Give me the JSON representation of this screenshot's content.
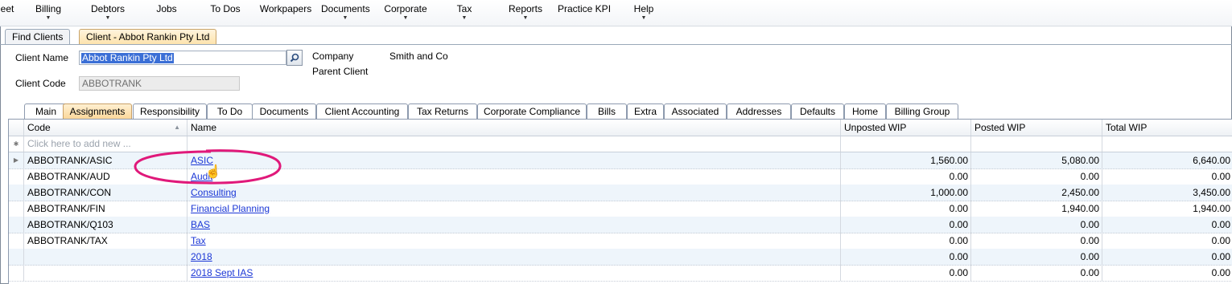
{
  "menu": [
    {
      "label": "eet",
      "dropdown": false
    },
    {
      "label": "Billing",
      "dropdown": true
    },
    {
      "label": "Debtors",
      "dropdown": true
    },
    {
      "label": "Jobs",
      "dropdown": false
    },
    {
      "label": "To Dos",
      "dropdown": false
    },
    {
      "label": "Workpapers",
      "dropdown": false
    },
    {
      "label": "Documents",
      "dropdown": true
    },
    {
      "label": "Corporate",
      "dropdown": true
    },
    {
      "label": "Tax",
      "dropdown": true
    },
    {
      "label": "Reports",
      "dropdown": true
    },
    {
      "label": "Practice KPI",
      "dropdown": false
    },
    {
      "label": "Help",
      "dropdown": true
    }
  ],
  "doc_tabs": [
    {
      "label": "Find Clients",
      "active": false
    },
    {
      "label": "Client - Abbot Rankin Pty Ltd",
      "active": true
    }
  ],
  "header": {
    "client_name_label": "Client Name",
    "client_name_value": "Abbot Rankin Pty Ltd",
    "client_code_label": "Client Code",
    "client_code_value": "ABBOTRANK",
    "company_label": "Company",
    "company_value": "Smith and Co",
    "parent_client_label": "Parent Client"
  },
  "detail_tabs": [
    {
      "label": "Main",
      "active": false
    },
    {
      "label": "Assignments",
      "active": true
    },
    {
      "label": "Responsibility",
      "active": false
    },
    {
      "label": "To Do",
      "active": false
    },
    {
      "label": "Documents",
      "active": false
    },
    {
      "label": "Client Accounting",
      "active": false
    },
    {
      "label": "Tax Returns",
      "active": false
    },
    {
      "label": "Corporate Compliance",
      "active": false
    },
    {
      "label": "Bills",
      "active": false
    },
    {
      "label": "Extra",
      "active": false
    },
    {
      "label": "Associated",
      "active": false
    },
    {
      "label": "Addresses",
      "active": false
    },
    {
      "label": "Defaults",
      "active": false
    },
    {
      "label": "Home",
      "active": false
    },
    {
      "label": "Billing Group",
      "active": false
    }
  ],
  "grid": {
    "columns": [
      "Code",
      "Name",
      "Unposted WIP",
      "Posted WIP",
      "Total WIP"
    ],
    "new_row_placeholder": "Click here to add new ...",
    "rows": [
      {
        "code": "ABBOTRANK/ASIC",
        "name": "ASIC",
        "unposted": "1,560.00",
        "posted": "5,080.00",
        "total": "6,640.00"
      },
      {
        "code": "ABBOTRANK/AUD",
        "name": "Audit",
        "unposted": "0.00",
        "posted": "0.00",
        "total": "0.00"
      },
      {
        "code": "ABBOTRANK/CON",
        "name": "Consulting",
        "unposted": "1,000.00",
        "posted": "2,450.00",
        "total": "3,450.00"
      },
      {
        "code": "ABBOTRANK/FIN",
        "name": "Financial Planning",
        "unposted": "0.00",
        "posted": "1,940.00",
        "total": "1,940.00"
      },
      {
        "code": "ABBOTRANK/Q103",
        "name": "BAS",
        "unposted": "0.00",
        "posted": "0.00",
        "total": "0.00"
      },
      {
        "code": "ABBOTRANK/TAX",
        "name": "Tax",
        "unposted": "0.00",
        "posted": "0.00",
        "total": "0.00"
      },
      {
        "code": "",
        "name": "2018",
        "unposted": "0.00",
        "posted": "0.00",
        "total": "0.00"
      },
      {
        "code": "",
        "name": "2018 Sept IAS",
        "unposted": "0.00",
        "posted": "0.00",
        "total": "0.00"
      }
    ]
  },
  "colors": {
    "accent": "#fbd79a",
    "link": "#1b37d6",
    "annotation": "#e0197a",
    "selection": "#3b6fd6"
  }
}
